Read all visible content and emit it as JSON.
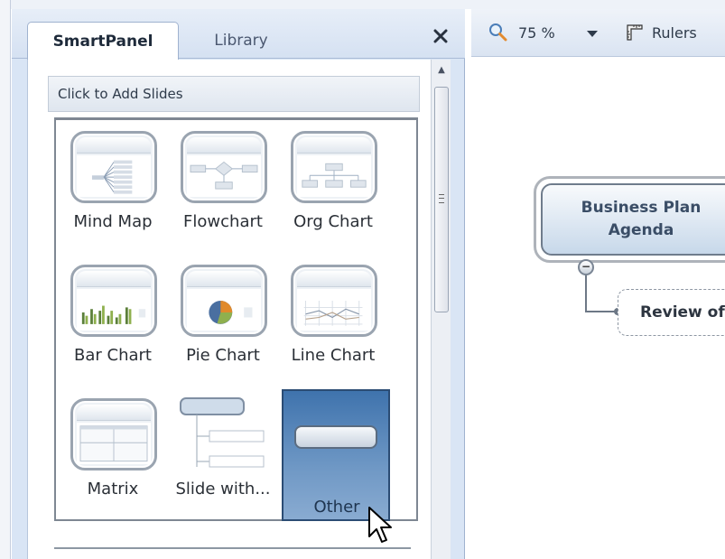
{
  "panel": {
    "tabs": [
      {
        "label": "SmartPanel",
        "active": true
      },
      {
        "label": "Library",
        "active": false
      }
    ],
    "close_glyph": "x",
    "section_header": "Click to Add Slides",
    "tiles": [
      {
        "label": "Mind Map",
        "icon": "mind-map-thumbnail"
      },
      {
        "label": "Flowchart",
        "icon": "flowchart-thumbnail"
      },
      {
        "label": "Org Chart",
        "icon": "org-chart-thumbnail"
      },
      {
        "label": "Bar Chart",
        "icon": "bar-chart-thumbnail"
      },
      {
        "label": "Pie Chart",
        "icon": "pie-chart-thumbnail"
      },
      {
        "label": "Line Chart",
        "icon": "line-chart-thumbnail"
      },
      {
        "label": "Matrix",
        "icon": "matrix-thumbnail"
      },
      {
        "label": "Slide with...",
        "icon": "slide-with-topics-thumbnail"
      },
      {
        "label": "Other",
        "icon": "other-thumbnail",
        "selected": true
      }
    ]
  },
  "toolbar": {
    "zoom_value": "75 %",
    "rulers_label": "Rulers"
  },
  "canvas": {
    "central_topic_line1": "Business Plan",
    "central_topic_line2": "Agenda",
    "collapse_glyph": "−",
    "subtopic_label": "Review of"
  },
  "colors": {
    "panel_bg": "#d9e5f5",
    "selected_tile": "#3f73ad",
    "topic_fill": "#c7d8ea"
  }
}
